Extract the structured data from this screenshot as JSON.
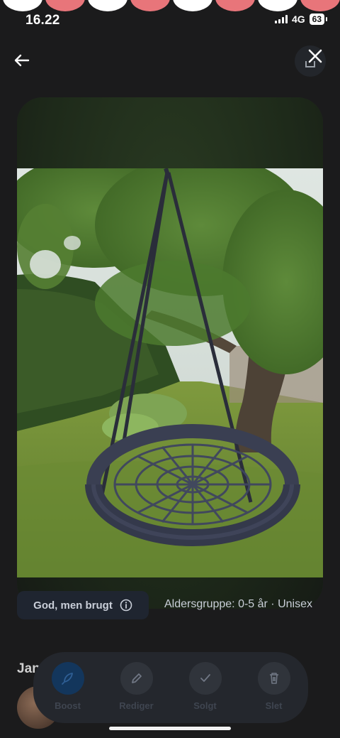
{
  "status_bar": {
    "time": "16.22",
    "network": "4G",
    "battery": "63"
  },
  "condition_chip": {
    "label": "God, men brugt"
  },
  "details": {
    "age_group": "Aldersgruppe: 0-5 år · Unisex"
  },
  "seller": {
    "name_partial": "Jan"
  },
  "actions": [
    {
      "label": "Boost",
      "icon": "rocket-icon"
    },
    {
      "label": "Rediger",
      "icon": "pencil-icon"
    },
    {
      "label": "Solgt",
      "icon": "checkmark-icon"
    },
    {
      "label": "Slet",
      "icon": "trash-icon"
    }
  ],
  "colors": {
    "background": "#1b1b1c",
    "action_bar": "#24272d",
    "boost_active": "#13365c",
    "chip": "#1f2530",
    "bubble_pink": "#e8757a",
    "bubble_white": "#ffffff"
  },
  "photo": {
    "subject": "Round rope nest swing hanging from a tree in a garden"
  }
}
